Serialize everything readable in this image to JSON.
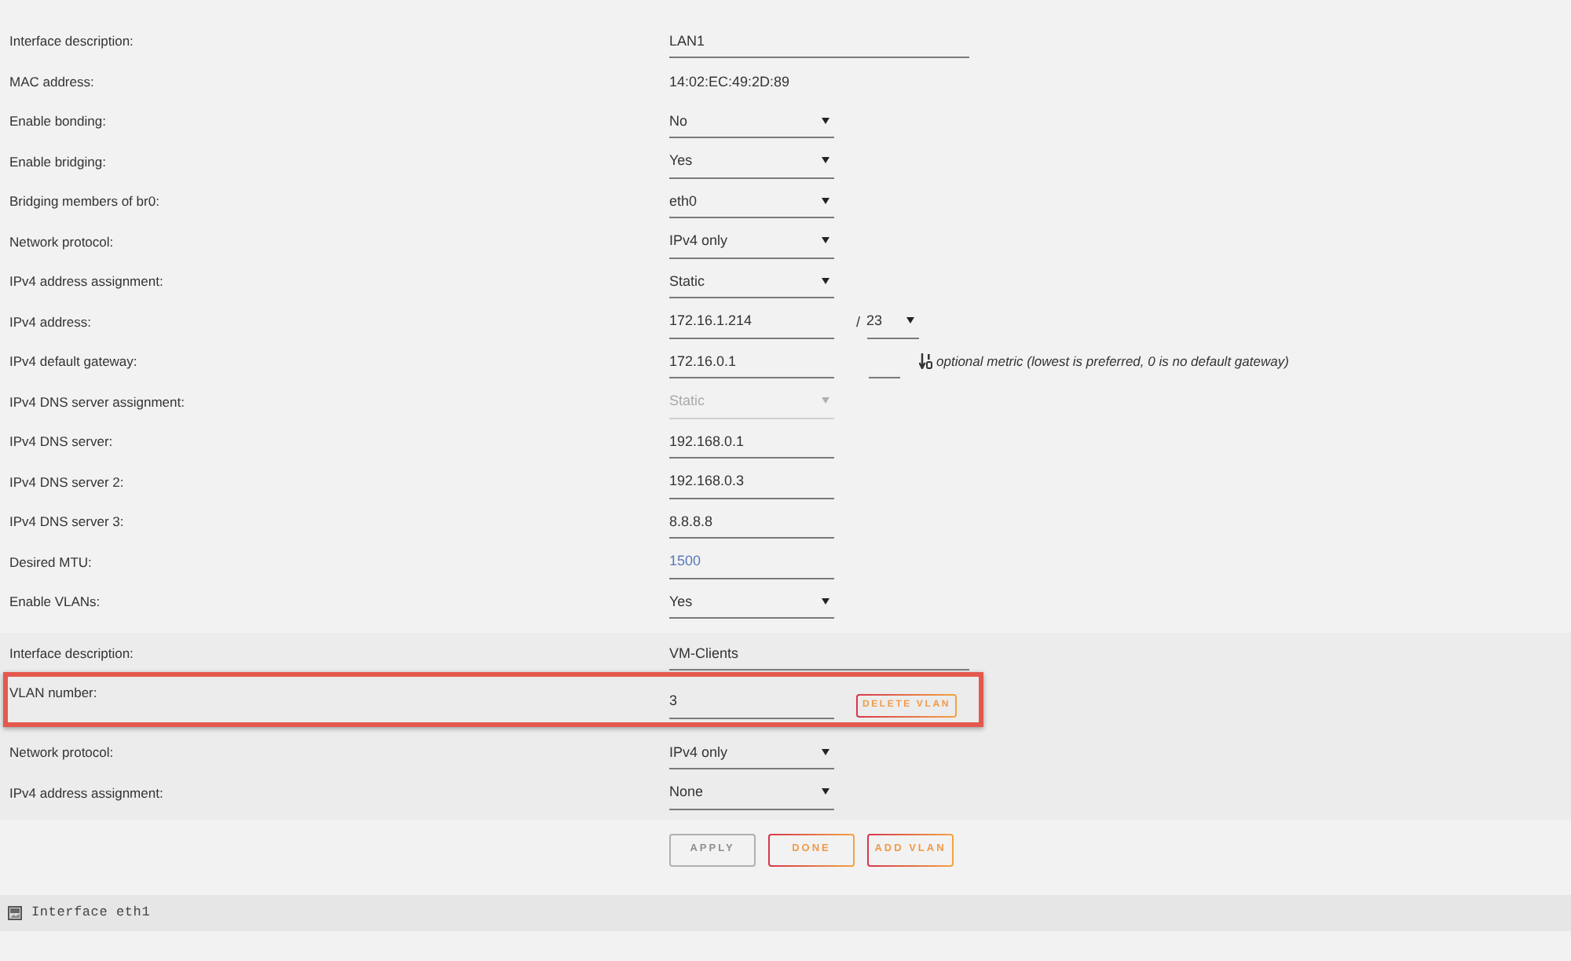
{
  "fields": [
    {
      "kind": "longtext",
      "label": "Interface description:",
      "value": "LAN1",
      "disabled": false
    },
    {
      "kind": "static",
      "label": "MAC address:",
      "value": "14:02:EC:49:2D:89",
      "disabled": false
    },
    {
      "kind": "select",
      "label": "Enable bonding:",
      "value": "No",
      "disabled": false
    },
    {
      "kind": "select",
      "label": "Enable bridging:",
      "value": "Yes",
      "disabled": false
    },
    {
      "kind": "select",
      "label": "Bridging members of br0:",
      "value": "eth0",
      "disabled": false
    },
    {
      "kind": "select",
      "label": "Network protocol:",
      "value": "IPv4 only",
      "disabled": false
    },
    {
      "kind": "select",
      "label": "IPv4 address assignment:",
      "value": "Static",
      "disabled": false
    },
    {
      "kind": "text",
      "label": "IPv4 address:",
      "value": "172.16.1.214",
      "disabled": false,
      "prefix": {
        "separator": "/",
        "value": "23"
      }
    },
    {
      "kind": "text",
      "label": "IPv4 default gateway:",
      "value": "172.16.0.1",
      "disabled": false,
      "metric": {
        "note": "optional metric (lowest is preferred, 0 is no default gateway)"
      }
    },
    {
      "kind": "select",
      "label": "IPv4 DNS server assignment:",
      "value": "Static",
      "disabled": true
    },
    {
      "kind": "text",
      "label": "IPv4 DNS server:",
      "value": "192.168.0.1",
      "disabled": false
    },
    {
      "kind": "text",
      "label": "IPv4 DNS server 2:",
      "value": "192.168.0.3",
      "disabled": false
    },
    {
      "kind": "text",
      "label": "IPv4 DNS server 3:",
      "value": "8.8.8.8",
      "disabled": false
    },
    {
      "kind": "text",
      "label": "Desired MTU:",
      "placeholder": "1500",
      "disabled": false
    },
    {
      "kind": "select",
      "label": "Enable VLANs:",
      "value": "Yes",
      "disabled": false
    }
  ],
  "vlans": [
    {
      "fields": [
        {
          "kind": "longtext",
          "label": "Interface description:",
          "value": "VM-Clients",
          "disabled": false,
          "highlighted": false
        },
        {
          "kind": "text",
          "label": "VLAN number:",
          "value": "3",
          "disabled": false,
          "highlighted": true,
          "button": "DELETE VLAN"
        },
        {
          "kind": "select",
          "label": "Network protocol:",
          "value": "IPv4 only",
          "disabled": false,
          "highlighted": false
        },
        {
          "kind": "select",
          "label": "IPv4 address assignment:",
          "value": "None",
          "disabled": false,
          "highlighted": false
        }
      ]
    }
  ],
  "buttons": [
    {
      "label": "APPLY",
      "disabled": true
    },
    {
      "label": "DONE",
      "disabled": false
    },
    {
      "label": "ADD VLAN",
      "disabled": false
    }
  ],
  "next_section": {
    "title": "Interface eth1"
  }
}
